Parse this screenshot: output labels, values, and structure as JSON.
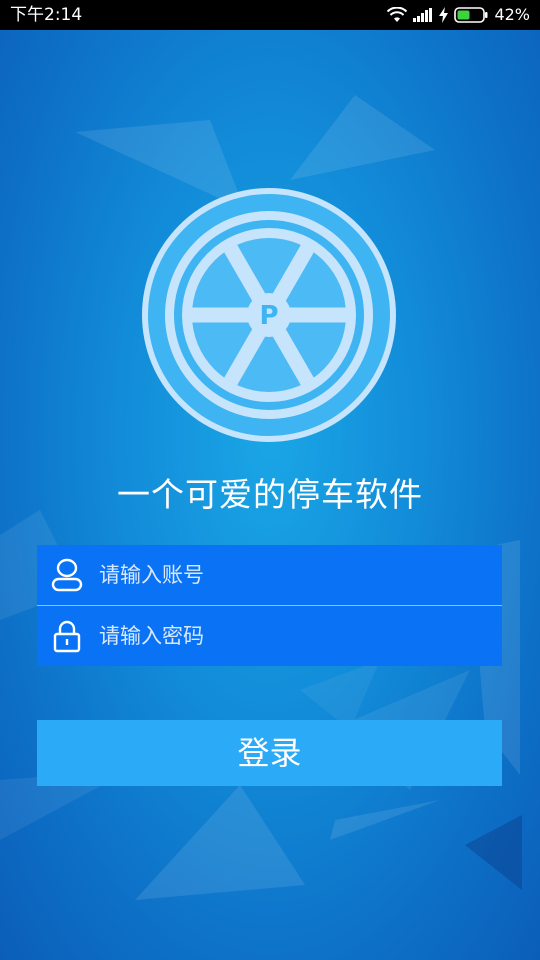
{
  "status_bar": {
    "time": "下午2:14",
    "battery_percent": "42%",
    "icons": [
      "wifi-icon",
      "signal-icon",
      "charging-icon",
      "battery-icon"
    ]
  },
  "app": {
    "logo_letter": "P",
    "slogan": "一个可爱的停车软件"
  },
  "form": {
    "account_placeholder": "请输入账号",
    "account_value": "",
    "password_placeholder": "请输入密码",
    "password_value": ""
  },
  "login_button": {
    "label": "登录"
  },
  "colors": {
    "background": "#128bd8",
    "field_background": "#0a73f5",
    "button_background": "#2aaaf7",
    "logo_light": "#c6e4fb",
    "logo_blue": "#3fb4f2"
  }
}
